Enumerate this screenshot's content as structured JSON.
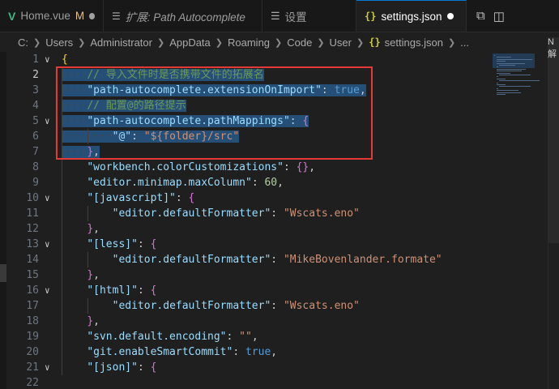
{
  "tabs": [
    {
      "icon": "vue-icon",
      "label": "Home.vue",
      "modified_flag": "M",
      "active": false
    },
    {
      "icon": "settings-preview-icon",
      "label": "扩展: Path Autocomplete",
      "active": false
    },
    {
      "icon": "settings-list-icon",
      "label": "设置",
      "active": false
    },
    {
      "icon": "json-braces-icon",
      "label": "settings.json",
      "active": true
    }
  ],
  "breadcrumb": {
    "segments": [
      "C:",
      "Users",
      "Administrator",
      "AppData",
      "Roaming",
      "Code",
      "User"
    ],
    "file": "settings.json",
    "ellipsis": "..."
  },
  "side_popup_text": "N解",
  "editor": {
    "current_line": 2,
    "highlighted_lines": "2-7",
    "lines": [
      {
        "n": "1",
        "tokens": [
          {
            "t": "{",
            "c": "br1"
          }
        ]
      },
      {
        "n": "2",
        "tokens": [
          {
            "t": "// 导入文件时是否携带文件的拓展名",
            "c": "c"
          }
        ]
      },
      {
        "n": "3",
        "tokens": [
          {
            "t": "\"path-autocomplete.extensionOnImport\"",
            "c": "k"
          },
          {
            "t": ": ",
            "c": "p"
          },
          {
            "t": "true",
            "c": "b"
          },
          {
            "t": ",",
            "c": "p"
          }
        ]
      },
      {
        "n": "4",
        "tokens": [
          {
            "t": "// 配置@的路径提示",
            "c": "c"
          }
        ]
      },
      {
        "n": "5",
        "tokens": [
          {
            "t": "\"path-autocomplete.pathMappings\"",
            "c": "k"
          },
          {
            "t": ": ",
            "c": "p"
          },
          {
            "t": "{",
            "c": "br2"
          }
        ]
      },
      {
        "n": "6",
        "tokens": [
          {
            "t": "\"@\"",
            "c": "k"
          },
          {
            "t": ": ",
            "c": "p"
          },
          {
            "t": "\"${folder}/src\"",
            "c": "s"
          }
        ]
      },
      {
        "n": "7",
        "tokens": [
          {
            "t": "}",
            "c": "br2"
          },
          {
            "t": ",",
            "c": "p"
          }
        ]
      },
      {
        "n": "8",
        "tokens": [
          {
            "t": "\"workbench.colorCustomizations\"",
            "c": "k"
          },
          {
            "t": ": ",
            "c": "p"
          },
          {
            "t": "{}",
            "c": "br2"
          },
          {
            "t": ",",
            "c": "p"
          }
        ]
      },
      {
        "n": "9",
        "tokens": [
          {
            "t": "\"editor.minimap.maxColumn\"",
            "c": "k"
          },
          {
            "t": ": ",
            "c": "p"
          },
          {
            "t": "60",
            "c": "n"
          },
          {
            "t": ",",
            "c": "p"
          }
        ]
      },
      {
        "n": "10",
        "tokens": [
          {
            "t": "\"[javascript]\"",
            "c": "k"
          },
          {
            "t": ": ",
            "c": "p"
          },
          {
            "t": "{",
            "c": "br2"
          }
        ]
      },
      {
        "n": "11",
        "tokens": [
          {
            "t": "\"editor.defaultFormatter\"",
            "c": "k"
          },
          {
            "t": ": ",
            "c": "p"
          },
          {
            "t": "\"Wscats.eno\"",
            "c": "s"
          }
        ]
      },
      {
        "n": "12",
        "tokens": [
          {
            "t": "}",
            "c": "br2"
          },
          {
            "t": ",",
            "c": "p"
          }
        ]
      },
      {
        "n": "13",
        "tokens": [
          {
            "t": "\"[less]\"",
            "c": "k"
          },
          {
            "t": ": ",
            "c": "p"
          },
          {
            "t": "{",
            "c": "br2"
          }
        ]
      },
      {
        "n": "14",
        "tokens": [
          {
            "t": "\"editor.defaultFormatter\"",
            "c": "k"
          },
          {
            "t": ": ",
            "c": "p"
          },
          {
            "t": "\"MikeBovenlander.formate\"",
            "c": "s"
          }
        ]
      },
      {
        "n": "15",
        "tokens": [
          {
            "t": "}",
            "c": "br2"
          },
          {
            "t": ",",
            "c": "p"
          }
        ]
      },
      {
        "n": "16",
        "tokens": [
          {
            "t": "\"[html]\"",
            "c": "k"
          },
          {
            "t": ": ",
            "c": "p"
          },
          {
            "t": "{",
            "c": "br2"
          }
        ]
      },
      {
        "n": "17",
        "tokens": [
          {
            "t": "\"editor.defaultFormatter\"",
            "c": "k"
          },
          {
            "t": ": ",
            "c": "p"
          },
          {
            "t": "\"Wscats.eno\"",
            "c": "s"
          }
        ]
      },
      {
        "n": "18",
        "tokens": [
          {
            "t": "}",
            "c": "br2"
          },
          {
            "t": ",",
            "c": "p"
          }
        ]
      },
      {
        "n": "19",
        "tokens": [
          {
            "t": "\"svn.default.encoding\"",
            "c": "k"
          },
          {
            "t": ": ",
            "c": "p"
          },
          {
            "t": "\"\"",
            "c": "s"
          },
          {
            "t": ",",
            "c": "p"
          }
        ]
      },
      {
        "n": "20",
        "tokens": [
          {
            "t": "\"git.enableSmartCommit\"",
            "c": "k"
          },
          {
            "t": ": ",
            "c": "p"
          },
          {
            "t": "true",
            "c": "b"
          },
          {
            "t": ",",
            "c": "p"
          }
        ]
      },
      {
        "n": "21",
        "tokens": [
          {
            "t": "\"[json]\"",
            "c": "k"
          },
          {
            "t": ": ",
            "c": "p"
          },
          {
            "t": "{",
            "c": "br2"
          }
        ]
      },
      {
        "n": "22",
        "tokens": []
      }
    ]
  },
  "colors": {
    "accent": "#0078d4",
    "selection": "#264f78",
    "annotation_box": "#e53935",
    "vue_icon": "#41b883",
    "json_icon": "#cbcb41"
  }
}
